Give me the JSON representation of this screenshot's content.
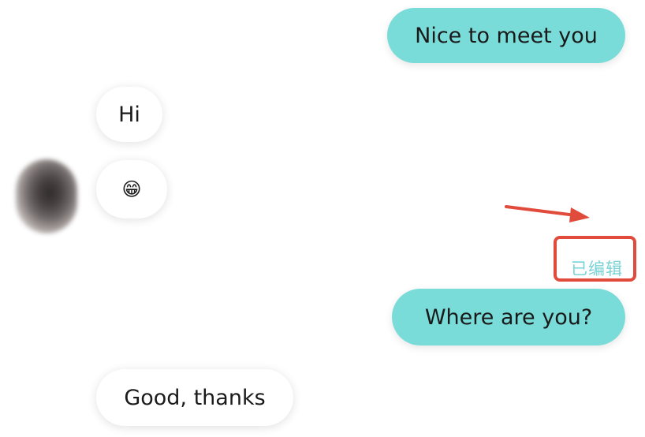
{
  "messages": [
    {
      "direction": "outgoing",
      "text": "Nice to meet you"
    },
    {
      "direction": "incoming",
      "text": "Hi"
    },
    {
      "direction": "incoming",
      "text": "😁"
    },
    {
      "direction": "outgoing",
      "text": "Where are you?",
      "status": "已编辑"
    },
    {
      "direction": "incoming",
      "text": "Good, thanks"
    }
  ],
  "annotation": {
    "color": "#e14b3b"
  },
  "colors": {
    "outgoing_bubble": "#79dcd9",
    "incoming_bubble": "#ffffff",
    "edited_label": "#79d3d5"
  }
}
